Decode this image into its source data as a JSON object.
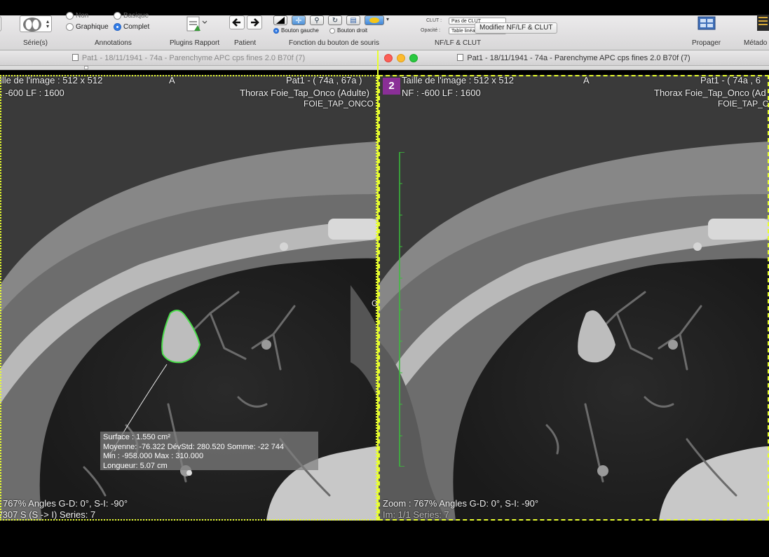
{
  "toolbar": {
    "series_radio_1": "Non",
    "series_radio_2": "Basique",
    "series_radio_3": "Graphique",
    "series_radio_4": "Complet",
    "labels": {
      "series": "Série(s)",
      "annotations": "Annotations",
      "plugins": "Plugins Rapport",
      "patient": "Patient",
      "mouse_function": "Fonction du bouton de souris",
      "wl_clut": "NF/LF & CLUT",
      "propagate": "Propager",
      "metadata": "Métado"
    },
    "mouse_left": "Bouton gauche",
    "mouse_right": "Bouton droit",
    "clut_label": "CLUT :",
    "clut_value": "Pas de CLUT",
    "opacity_label": "Opacité :",
    "opacity_value": "Table linéaire",
    "modify_button": "Modifier NF/LF & CLUT"
  },
  "left_viewer": {
    "title": "Pat1 - 18/11/1941 - 74a - Parenchyme APC cps fines 2.0 B70f (7)",
    "image_size": "ille de l'image : 512 x 512",
    "orientation_top": "A",
    "wl": ": -600 LF : 1600",
    "patient_info": "Pat1 - ( 74a , 67a )",
    "study": "Thorax Foie_Tap_Onco (Adulte)",
    "protocol": "FOIE_TAP_ONCO",
    "orientation_right": "GD",
    "zoom_line": "767% Angles G-D: 0°, S-I: -90°",
    "series_line": "/307  S (S -> I) Series:  7",
    "roi": {
      "surface": "Surface : 1.550 cm²",
      "mean": "Moyenne: -76.322   DévStd: 280.520   Somme: -22  744",
      "minmax": "Min : -958.000   Max : 310.000",
      "length": "Longueur: 5.07 cm"
    }
  },
  "right_viewer": {
    "title": "Pat1 - 18/11/1941 - 74a - Parenchyme APC cps fines 2.0 B70f (7)",
    "badge": "2",
    "image_size": "Taille de l'image : 512 x 512",
    "orientation_top": "A",
    "wl": "NF : -600 LF : 1600",
    "patient_info": "Pat1 - ( 74a , 6",
    "study": "Thorax Foie_Tap_Onco (Ad",
    "protocol": "FOIE_TAP_C",
    "zoom_line": "Zoom : 767% Angles G-D: 0°, S-I: -90°",
    "series_line": "Im: 1/1   Series:  7"
  },
  "colors": {
    "selection_border": "#e9ff2f",
    "roi_outline": "#4bdc4b",
    "ruler": "#3bbf3b",
    "badge": "#8a2f97"
  }
}
